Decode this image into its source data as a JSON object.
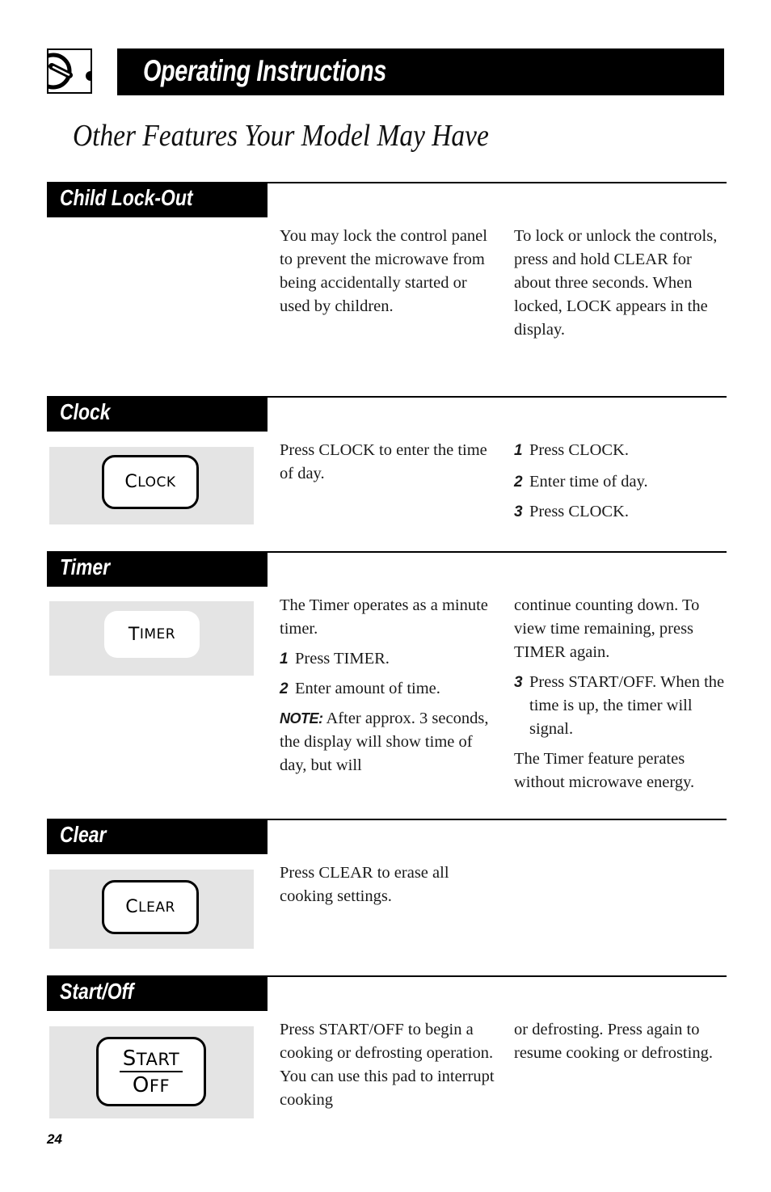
{
  "header": {
    "logo_icon": "microwave-dial-icon",
    "title": "Operating Instructions"
  },
  "page_subtitle": "Other Features Your Model May Have",
  "sections": {
    "child_lock": {
      "label": "Child Lock-Out",
      "col1": "You may lock the control panel to prevent the microwave from being accidentally started or used by children.",
      "col2": "To lock or unlock the controls, press and hold CLEAR for about three seconds. When locked, LOCK appears in the display."
    },
    "clock": {
      "label": "Clock",
      "pad": {
        "first": "C",
        "rest": "LOCK"
      },
      "col1": "Press CLOCK to enter the time of day.",
      "steps": [
        {
          "num": "1",
          "text": "Press CLOCK."
        },
        {
          "num": "2",
          "text": "Enter time of day."
        },
        {
          "num": "3",
          "text": "Press CLOCK."
        }
      ]
    },
    "timer": {
      "label": "Timer",
      "pad": {
        "first": "T",
        "rest": "IMER"
      },
      "intro": "The Timer operates as a minute timer.",
      "steps": [
        {
          "num": "1",
          "text": "Press TIMER."
        },
        {
          "num": "2",
          "text": "Enter amount of time."
        },
        {
          "num": "3",
          "text": "Press START/OFF. When the time is up, the timer will signal."
        }
      ],
      "note_label": "NOTE:",
      "note_text": " After approx. 3 seconds, the display will show time of day, but will",
      "continued": "continue counting down. To view time remaining, press TIMER again.",
      "footer": "The Timer feature perates without microwave energy."
    },
    "clear": {
      "label": "Clear",
      "pad": {
        "first": "C",
        "rest": "LEAR"
      },
      "col1": "Press CLEAR to erase all cooking settings."
    },
    "start_off": {
      "label": "Start/Off",
      "pad": {
        "top_first": "S",
        "top_rest": "TART",
        "bottom_first": "O",
        "bottom_rest": "FF"
      },
      "col1": "Press START/OFF to begin a cooking or defrosting operation. You can use this pad to interrupt cooking",
      "col2": "or defrosting. Press again to resume cooking or defrosting."
    }
  },
  "page_number": "24"
}
